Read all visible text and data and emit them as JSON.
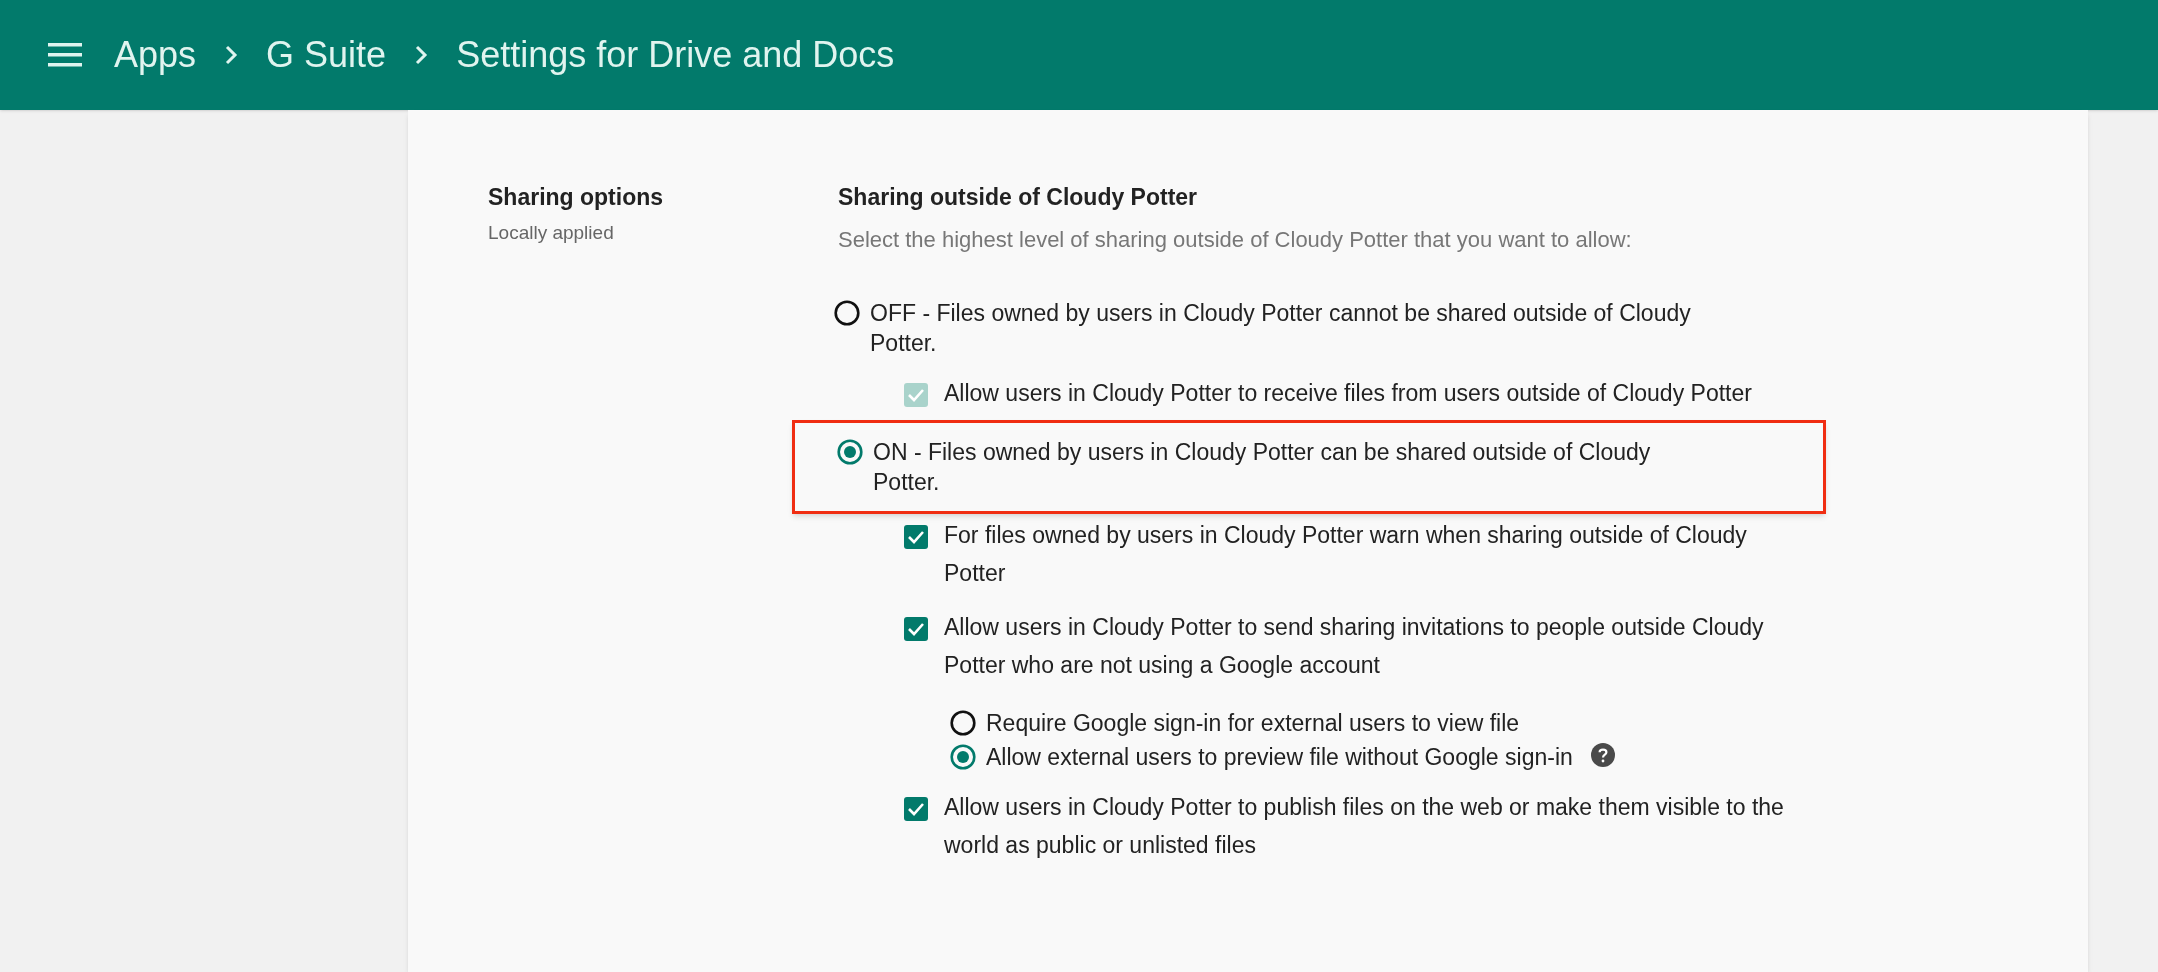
{
  "header": {
    "breadcrumbs": [
      "Apps",
      "G Suite",
      "Settings for Drive and Docs"
    ]
  },
  "section": {
    "title": "Sharing options",
    "subtitle": "Locally applied"
  },
  "setting": {
    "title": "Sharing outside of Cloudy Potter",
    "description": "Select the highest level of sharing outside of Cloudy Potter that you want to allow:",
    "options": [
      {
        "kind": "radio",
        "label": "OFF - Files owned by users in Cloudy Potter cannot be shared outside of Cloudy Potter.",
        "selected": false,
        "highlighted": false,
        "children": [
          {
            "kind": "checkbox",
            "label": "Allow users in Cloudy Potter to receive files from users outside of Cloudy Potter",
            "checked": true,
            "disabled": true
          }
        ]
      },
      {
        "kind": "radio",
        "label": "ON - Files owned by users in Cloudy Potter can be shared outside of Cloudy Potter.",
        "selected": true,
        "highlighted": true,
        "children": [
          {
            "kind": "checkbox",
            "label": "For files owned by users in Cloudy Potter warn when sharing outside of Cloudy Potter",
            "checked": true,
            "disabled": false
          },
          {
            "kind": "checkbox",
            "label": "Allow users in Cloudy Potter to send sharing invitations to people outside Cloudy Potter who are not using a Google account",
            "checked": true,
            "disabled": false,
            "children": [
              {
                "kind": "radio",
                "label": "Require Google sign-in for external users to view file",
                "selected": false,
                "help": false
              },
              {
                "kind": "radio",
                "label": "Allow external users to preview file without Google sign-in",
                "selected": true,
                "help": true
              }
            ]
          },
          {
            "kind": "checkbox",
            "label": "Allow users in Cloudy Potter to publish files on the web or make them visible to the world as public or unlisted files",
            "checked": true,
            "disabled": false
          }
        ]
      }
    ]
  }
}
